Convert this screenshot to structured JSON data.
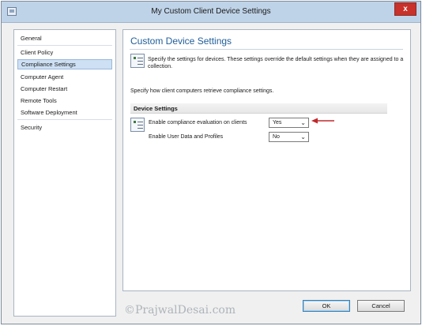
{
  "window": {
    "title": "My Custom Client Device Settings",
    "close_label": "x"
  },
  "sidebar": {
    "items": [
      {
        "label": "General",
        "selected": false
      },
      {
        "label": "Client Policy",
        "selected": false
      },
      {
        "label": "Compliance Settings",
        "selected": true
      },
      {
        "label": "Computer Agent",
        "selected": false
      },
      {
        "label": "Computer Restart",
        "selected": false
      },
      {
        "label": "Remote Tools",
        "selected": false
      },
      {
        "label": "Software Deployment",
        "selected": false
      },
      {
        "label": "Security",
        "selected": false
      }
    ]
  },
  "main": {
    "heading": "Custom Device Settings",
    "description": "Specify the settings for devices. These settings override the default settings when they are assigned to a collection.",
    "specify_text": "Specify how client computers retrieve compliance settings.",
    "group_title": "Device Settings",
    "settings": [
      {
        "label": "Enable compliance evaluation on clients",
        "value": "Yes"
      },
      {
        "label": "Enable User Data and Profiles",
        "value": "No"
      }
    ]
  },
  "footer": {
    "watermark": "©PrajwalDesai.com",
    "ok_label": "OK",
    "cancel_label": "Cancel"
  },
  "colors": {
    "heading": "#1f5d9a",
    "selection": "#cde0f4",
    "close_button": "#c8322b",
    "annotation_arrow": "#c0282b"
  }
}
